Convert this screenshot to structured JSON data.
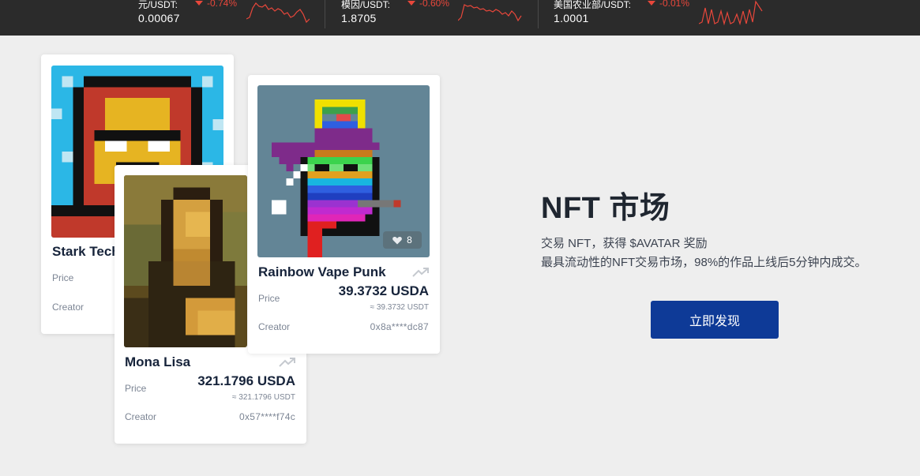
{
  "ticker": [
    {
      "pair": "元/USDT:",
      "change": "-0.74%",
      "price": "0.00067",
      "icon": "arrow-down-icon"
    },
    {
      "pair": "模因/USDT:",
      "change": "-0.60%",
      "price": "1.8705",
      "icon": "arrow-down-icon"
    },
    {
      "pair": "美国农业部/USDT:",
      "change": "-0.01%",
      "price": "1.0001",
      "icon": "arrow-down-icon"
    }
  ],
  "colors": {
    "down": "#e8473b",
    "accent": "#0e3a97",
    "bar": "#2b2b2b"
  },
  "cards": {
    "stark": {
      "title": "Stark Tech",
      "price_label": "Price",
      "creator_label": "Creator"
    },
    "mona": {
      "title": "Mona Lisa",
      "price_label": "Price",
      "amount": "321.1796 USDA",
      "approx": "≈ 321.1796 USDT",
      "creator_label": "Creator",
      "creator": "0x57****f74c"
    },
    "punk": {
      "title": "Rainbow Vape Punk",
      "price_label": "Price",
      "amount": "39.3732 USDA",
      "approx": "≈ 39.3732 USDT",
      "creator_label": "Creator",
      "creator": "0x8a****dc87",
      "likes": "8"
    }
  },
  "hero": {
    "title": "NFT 市场",
    "line1": "交易 NFT，获得 $AVATAR 奖励",
    "line2": "最具流动性的NFT交易市场，98%的作品上线后5分钟内成交。",
    "cta": "立即发现"
  }
}
